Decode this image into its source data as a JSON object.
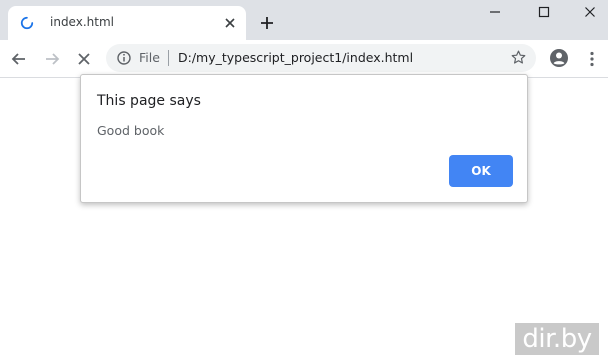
{
  "tab": {
    "title": "index.html",
    "spinner_icon": "loading-spinner-icon",
    "close_icon": "close-icon"
  },
  "new_tab_icon": "plus-icon",
  "window_controls": [
    "minimize-icon",
    "maximize-icon",
    "close-icon"
  ],
  "toolbar": {
    "back_icon": "arrow-left-icon",
    "forward_icon": "arrow-right-icon",
    "stop_icon": "stop-x-icon",
    "profile_icon": "account-icon",
    "menu_icon": "vertical-dots-icon"
  },
  "omnibox": {
    "info_icon": "info-icon",
    "scheme_label": "File",
    "url": "D:/my_typescript_project1/index.html",
    "star_icon": "star-outline-icon"
  },
  "dialog": {
    "title": "This page says",
    "message": "Good book",
    "ok_label": "OK"
  },
  "watermark": {
    "text": "dir.by"
  },
  "colors": {
    "tabstrip_bg": "#dee1e6",
    "omnibox_bg": "#f1f3f4",
    "accent_blue": "#4285f4",
    "spinner_blue": "#1a73e8",
    "watermark_bg": "#c9c9c9"
  }
}
